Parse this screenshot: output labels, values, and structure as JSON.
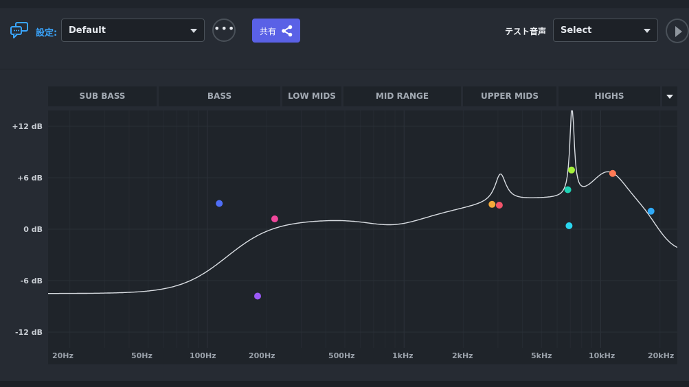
{
  "toolbar": {
    "preset_label": "設定:",
    "preset_value": "Default",
    "share_label": "共有",
    "test_audio_label": "テスト音声",
    "test_audio_value": "Select"
  },
  "bands": [
    "SUB BASS",
    "BASS",
    "LOW MIDS",
    "MID RANGE",
    "UPPER MIDS",
    "HIGHS"
  ],
  "graph": {
    "y_labels": [
      "+12 dB",
      "+6 dB",
      "0 dB",
      "-6 dB",
      "-12 dB"
    ],
    "x_labels": [
      "20Hz",
      "50Hz",
      "100Hz",
      "200Hz",
      "500Hz",
      "1kHz",
      "2kHz",
      "5kHz",
      "10kHz",
      "20kHz"
    ],
    "curve_color": "#d9dde2",
    "points": [
      {
        "freq": 115,
        "gain": 3.0,
        "color": "#4f6ef7"
      },
      {
        "freq": 180,
        "gain": -7.8,
        "color": "#9b59f7"
      },
      {
        "freq": 220,
        "gain": 1.2,
        "color": "#f0479b"
      },
      {
        "freq": 2800,
        "gain": 2.9,
        "color": "#f4a93a"
      },
      {
        "freq": 3050,
        "gain": 2.8,
        "color": "#f2546a"
      },
      {
        "freq": 6800,
        "gain": 4.6,
        "color": "#1fd2b4"
      },
      {
        "freq": 6900,
        "gain": 0.4,
        "color": "#2ad6ef"
      },
      {
        "freq": 7100,
        "gain": 6.9,
        "color": "#a4f13b"
      },
      {
        "freq": 11500,
        "gain": 6.5,
        "color": "#ff7a55"
      },
      {
        "freq": 18000,
        "gain": 2.1,
        "color": "#2fa9f7"
      }
    ]
  }
}
